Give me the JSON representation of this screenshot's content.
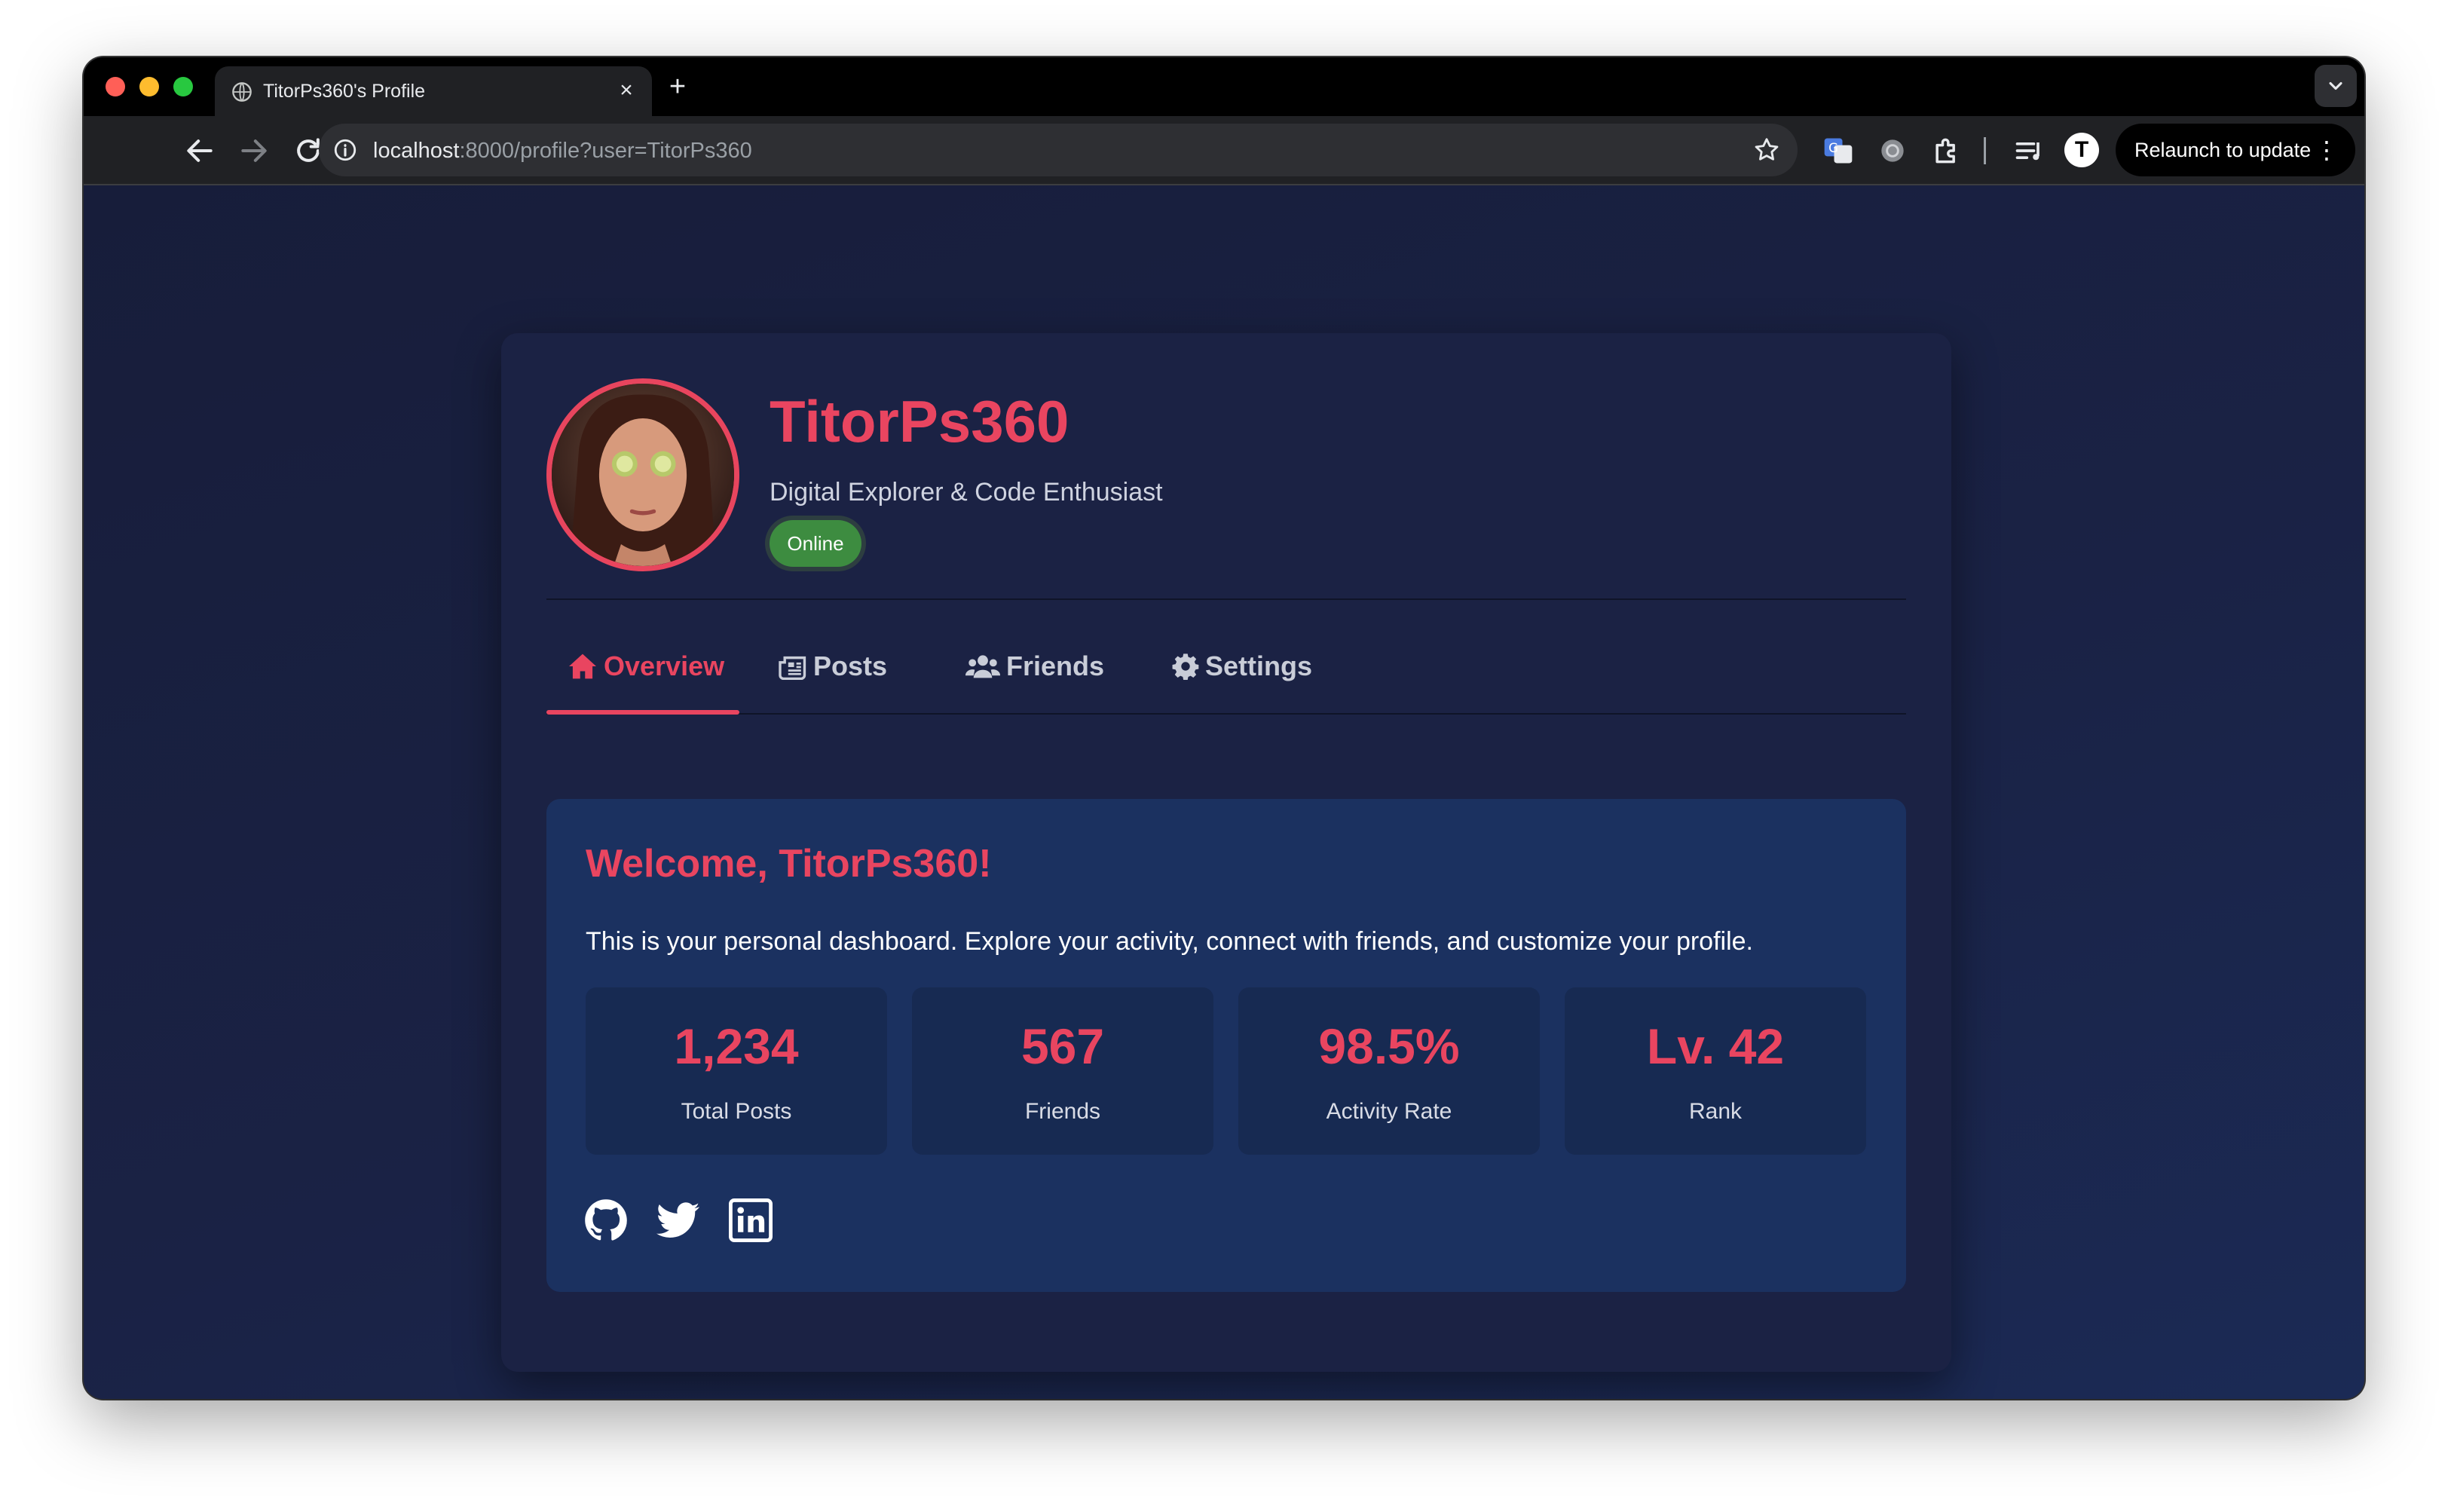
{
  "browser": {
    "tab_title": "TitorPs360's Profile",
    "new_tab_symbol": "+",
    "close_symbol": "×",
    "url_host": "localhost",
    "url_rest": ":8000/profile?user=TitorPs360",
    "profile_initial": "T",
    "relaunch_label": "Relaunch to update",
    "menu_symbol": "⋮"
  },
  "profile": {
    "username": "TitorPs360",
    "tagline": "Digital Explorer & Code Enthusiast",
    "status": "Online"
  },
  "nav": {
    "tabs": [
      {
        "label": "Overview",
        "icon": "home-icon",
        "active": true
      },
      {
        "label": "Posts",
        "icon": "newspaper-icon",
        "active": false
      },
      {
        "label": "Friends",
        "icon": "users-icon",
        "active": false
      },
      {
        "label": "Settings",
        "icon": "gear-icon",
        "active": false
      }
    ]
  },
  "overview": {
    "welcome": "Welcome, TitorPs360!",
    "intro": "This is your personal dashboard. Explore your activity, connect with friends, and customize your profile.",
    "stats": [
      {
        "value": "1,234",
        "label": "Total Posts"
      },
      {
        "value": "567",
        "label": "Friends"
      },
      {
        "value": "98.5%",
        "label": "Activity Rate"
      },
      {
        "value": "Lv. 42",
        "label": "Rank"
      }
    ],
    "social": [
      "github-icon",
      "twitter-icon",
      "linkedin-icon"
    ]
  },
  "colors": {
    "accent": "#e94560",
    "status_online": "#3d8c40",
    "panel": "#1b3160",
    "card": "#1b2244"
  }
}
